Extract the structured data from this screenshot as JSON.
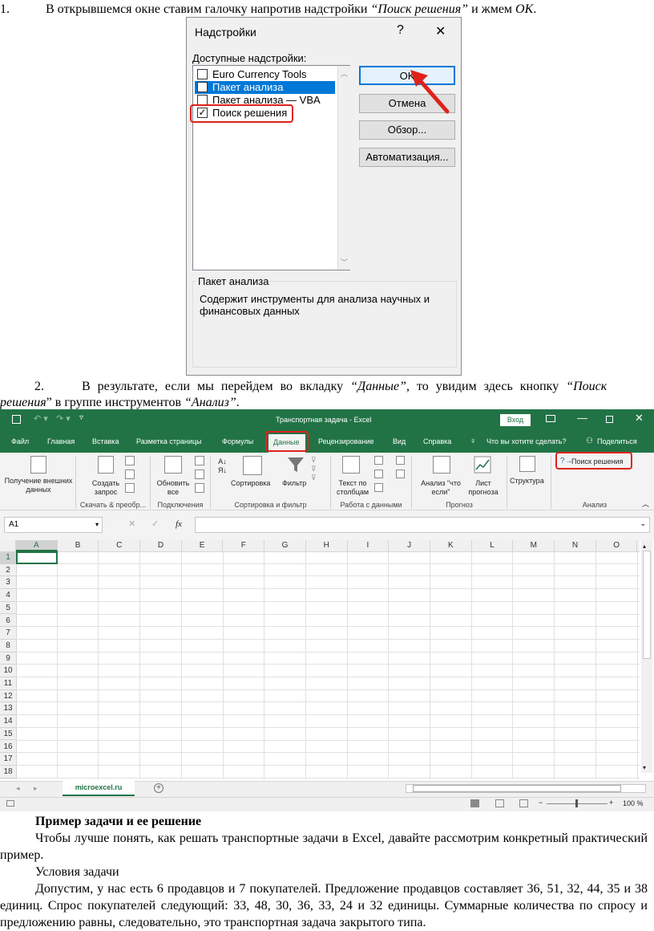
{
  "step1": {
    "num": "1.",
    "pre": "В открывшемся окне ставим галочку напротив надстройки ",
    "em": "“Поиск решения”",
    "mid": " и жмем ",
    "em2": "ОК",
    "post": "."
  },
  "dialog": {
    "title": "Надстройки",
    "help": "?",
    "close": "✕",
    "list_label": "Доступные надстройки:",
    "items": [
      {
        "label": "Euro Currency Tools",
        "checked": false,
        "selected": false
      },
      {
        "label": "Пакет анализа",
        "checked": false,
        "selected": true
      },
      {
        "label": "Пакет анализа — VBA",
        "checked": false,
        "selected": false
      },
      {
        "label": "Поиск решения",
        "checked": true,
        "selected": false
      }
    ],
    "buttons": {
      "ok": "OK",
      "cancel": "Отмена",
      "browse": "Обзор...",
      "automation": "Автоматизация..."
    },
    "desc_title": "Пакет анализа",
    "desc_text": "Содержит инструменты для анализа научных и финансовых данных"
  },
  "step2": {
    "num": "2.",
    "line1_pre": "В результате, если мы перейдем во вкладку ",
    "line1_em": "“Данные”",
    "line1_post": ", то увидим здесь кнопку ",
    "line1_em2": "“Поиск",
    "line2_em": "решения",
    "line2_mid": "” в группе инструментов ",
    "line2_em2": "“Анализ”",
    "line2_post": "."
  },
  "excel": {
    "title": "Транспортная задача - Excel",
    "login": "Вход",
    "tabs": [
      "Файл",
      "Главная",
      "Вставка",
      "Разметка страницы",
      "Формулы",
      "Данные",
      "Рецензирование",
      "Вид",
      "Справка"
    ],
    "tell_me": "Что вы хотите сделать?",
    "share": "Поделиться",
    "ribbon": {
      "get_data": "Получение внешних данных",
      "create_query": "Создать запрос",
      "refresh_all": "Обновить все",
      "sort": "Сортировка",
      "filter": "Фильтр",
      "text_to_columns": "Текст по столбцам",
      "what_if": "Анализ \"что если\"",
      "forecast": "Лист прогноза",
      "outline": "Структура",
      "solver": "Поиск решения",
      "groups": [
        "Скачать & преобр...",
        "Подключения",
        "Сортировка и фильтр",
        "Работа с данными",
        "Прогноз",
        "Анализ"
      ]
    },
    "name_box": "A1",
    "fx": "fx",
    "columns": [
      "A",
      "B",
      "C",
      "D",
      "E",
      "F",
      "G",
      "H",
      "I",
      "J",
      "K",
      "L",
      "M",
      "N",
      "O"
    ],
    "rows": [
      "1",
      "2",
      "3",
      "4",
      "5",
      "6",
      "7",
      "8",
      "9",
      "10",
      "11",
      "12",
      "13",
      "14",
      "15",
      "16",
      "17",
      "18"
    ],
    "sheet_tab": "microexcel.ru",
    "zoom": "100 %",
    "colors": {
      "brand": "#217346",
      "highlight": "#e0221b"
    }
  },
  "text": {
    "heading": "Пример задачи и ее решение",
    "p1": "Чтобы лучше понять, как решать транспортные задачи в Excel, давайте рассмотрим конкретный практический пример.",
    "sub": "Условия задачи",
    "p2": "Допустим, у нас есть 6 продавцов и 7 покупателей. Предложение продавцов составляет 36, 51, 32, 44, 35 и 38 единиц. Спрос покупателей следующий: 33, 48, 30, 36, 33, 24 и 32 единицы. Суммарные количества по спросу и предложению равны, следовательно, это транспортная задача закрытого типа."
  }
}
